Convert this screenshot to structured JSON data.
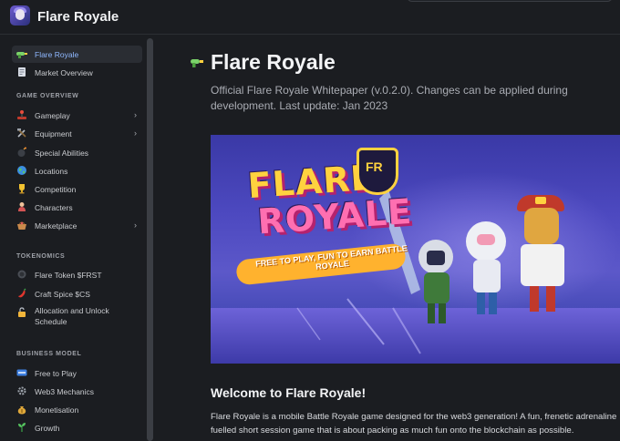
{
  "app": {
    "title": "Flare Royale",
    "logo_icon": "flare-royale-avatar-icon"
  },
  "sidebar": {
    "top_items": [
      {
        "label": "Flare Royale",
        "icon": "raygun-icon",
        "active": true
      },
      {
        "label": "Market Overview",
        "icon": "document-icon"
      }
    ],
    "sections": [
      {
        "heading": "GAME OVERVIEW",
        "items": [
          {
            "label": "Gameplay",
            "icon": "joystick-icon",
            "chevron": true
          },
          {
            "label": "Equipment",
            "icon": "hammer-wrench-icon",
            "chevron": true
          },
          {
            "label": "Special Abilities",
            "icon": "bomb-icon"
          },
          {
            "label": "Locations",
            "icon": "globe-icon"
          },
          {
            "label": "Competition",
            "icon": "trophy-icon"
          },
          {
            "label": "Characters",
            "icon": "person-icon"
          },
          {
            "label": "Marketplace",
            "icon": "basket-icon",
            "chevron": true
          }
        ]
      },
      {
        "heading": "TOKENOMICS",
        "items": [
          {
            "label": "Flare Token $FRST",
            "icon": "coin-icon"
          },
          {
            "label": "Craft Spice $CS",
            "icon": "chili-pepper-icon"
          },
          {
            "label": "Allocation and Unlock Schedule",
            "icon": "unlock-icon"
          }
        ]
      },
      {
        "heading": "BUSINESS MODEL",
        "items": [
          {
            "label": "Free to Play",
            "icon": "free-badge-icon"
          },
          {
            "label": "Web3 Mechanics",
            "icon": "gear-icon"
          },
          {
            "label": "Monetisation",
            "icon": "money-bag-icon"
          },
          {
            "label": "Growth",
            "icon": "plant-icon"
          }
        ]
      }
    ]
  },
  "main": {
    "title": "Flare Royale",
    "title_icon": "raygun-icon",
    "subtitle": "Official Flare Royale Whitepaper (v.0.2.0). Changes can be applied during development. Last update: Jan 2023",
    "hero": {
      "logo_line1": "FLARE",
      "logo_line2": "ROYALE",
      "badge": "FR",
      "banner": "FREE TO PLAY, FUN TO EARN BATTLE ROYALE"
    },
    "welcome_heading": "Welcome to Flare Royale!",
    "paragraph": "Flare Royale is a mobile Battle Royale game designed for the web3 generation! A fun, frenetic adrenaline fuelled short session game that is about packing as much fun onto the blockchain as possible."
  },
  "colors": {
    "background": "#1b1d21",
    "active_label": "#8fb8ff",
    "banner": "#ffb22e",
    "logo_yellow": "#ffd23f"
  }
}
